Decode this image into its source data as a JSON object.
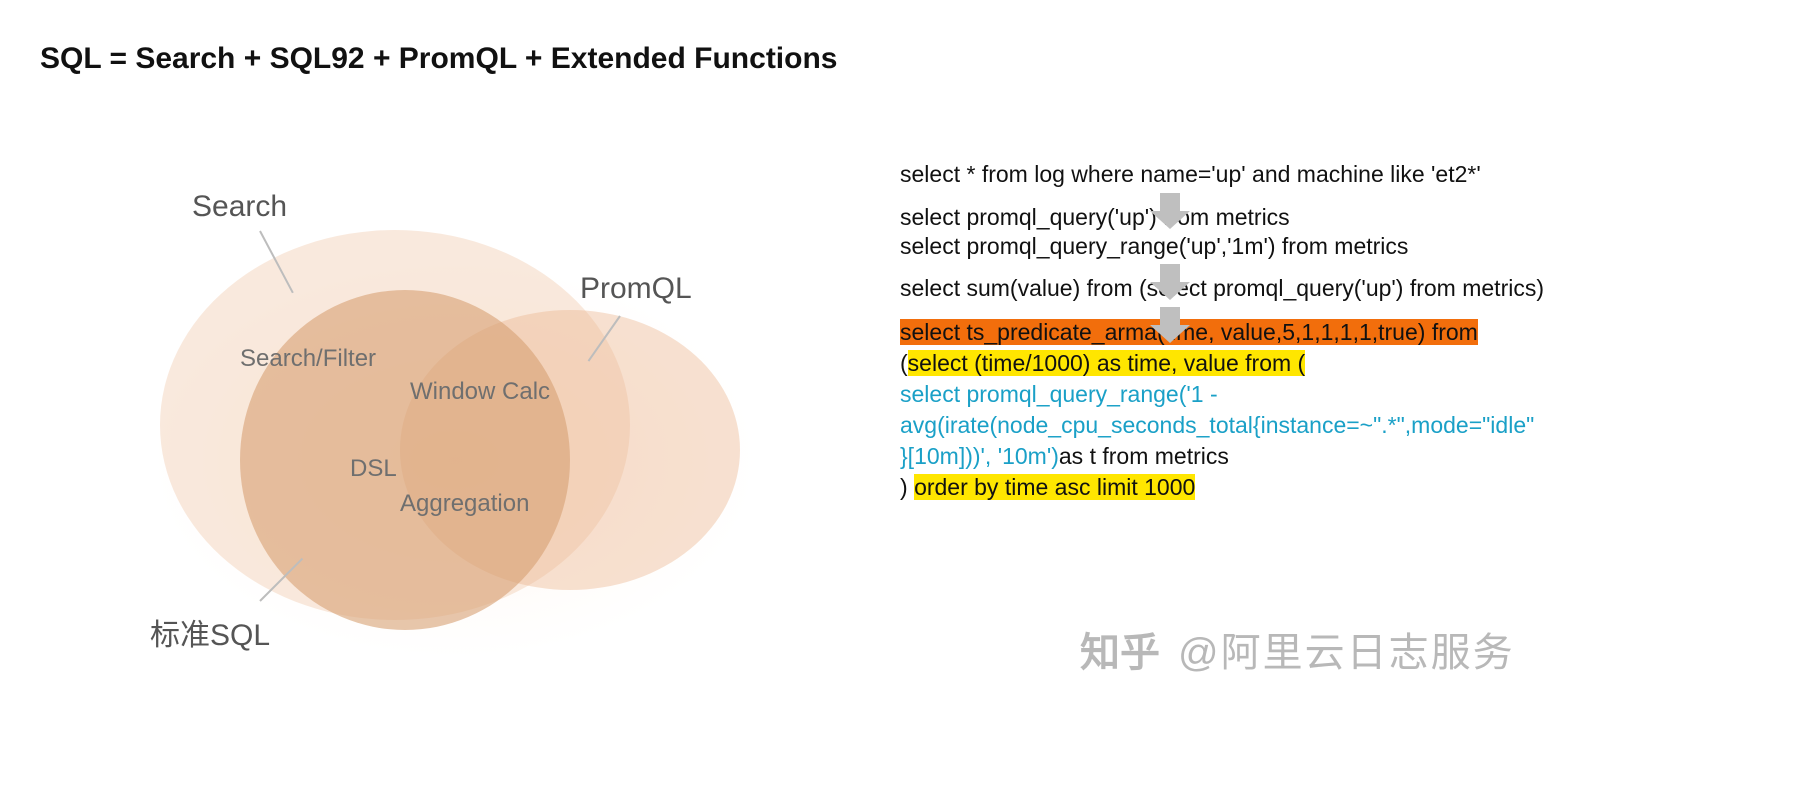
{
  "title": "SQL = Search + SQL92 + PromQL + Extended Functions",
  "venn": {
    "labels": {
      "search": "Search",
      "promql": "PromQL",
      "sql": "标准SQL",
      "search_filter": "Search/Filter",
      "window_calc": "Window Calc",
      "dsl": "DSL",
      "aggregation": "Aggregation"
    }
  },
  "queries": {
    "q1": "select * from log where name='up' and machine like 'et2*'",
    "q2a": "select promql_query('up') from metrics",
    "q2b": "select promql_query_range('up','1m') from metrics",
    "q3": "select sum(value) from (select promql_query('up') from metrics)",
    "final": {
      "l1": "select ts_predicate_arma(time, value,5,1,1,1,1,true) from",
      "l2_pre": "(",
      "l2_hl": "select (time/1000) as time, value from (",
      "l3": "select promql_query_range('1 -",
      "l4": "avg(irate(node_cpu_seconds_total{instance=~\".*\",mode=\"idle\"",
      "l5a": "}[10m]))', '10m')",
      "l5b": "as t from metrics",
      "l6_pre": ") ",
      "l6_hl": "order by time asc limit 1000"
    }
  },
  "watermark": {
    "logo": "知乎",
    "text": "@阿里云日志服务"
  }
}
